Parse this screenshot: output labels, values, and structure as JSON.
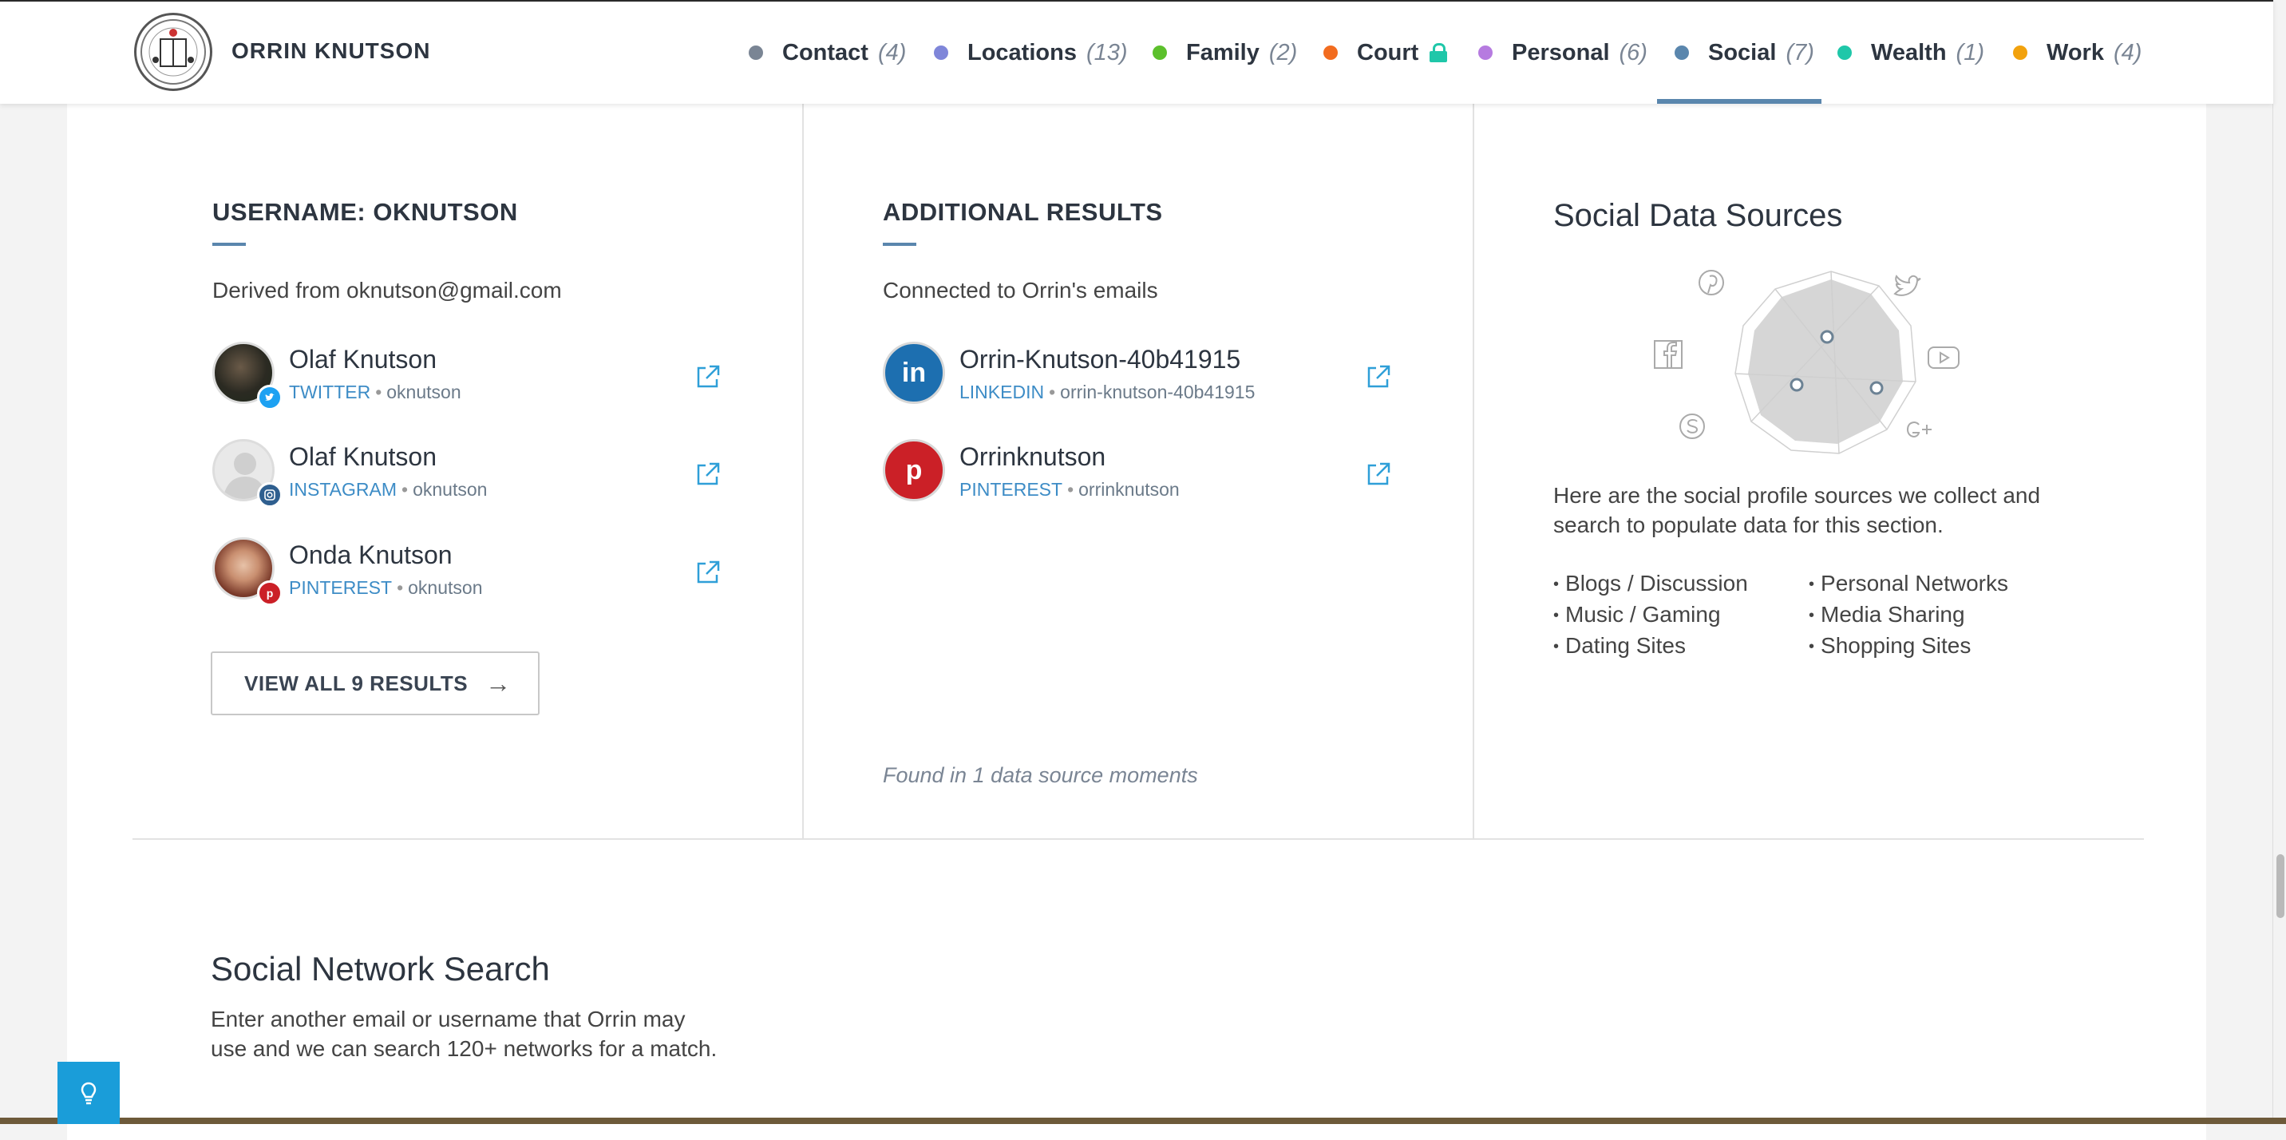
{
  "header": {
    "person_name": "ORRIN KNUTSON",
    "tabs": [
      {
        "label": "Contact",
        "count": "(4)",
        "dot_color": "#7a8594"
      },
      {
        "label": "Locations",
        "count": "(13)",
        "dot_color": "#7f86d9"
      },
      {
        "label": "Family",
        "count": "(2)",
        "dot_color": "#5cc02c"
      },
      {
        "label": "Court",
        "count": "",
        "dot_color": "#f26c1f",
        "locked": true
      },
      {
        "label": "Personal",
        "count": "(6)",
        "dot_color": "#b67be0"
      },
      {
        "label": "Social",
        "count": "(7)",
        "dot_color": "#5a86ad",
        "active": true
      },
      {
        "label": "Wealth",
        "count": "(1)",
        "dot_color": "#1fc7a9"
      },
      {
        "label": "Work",
        "count": "(4)",
        "dot_color": "#f2a20d"
      }
    ]
  },
  "username_section": {
    "title": "USERNAME: OKNUTSON",
    "subtitle": "Derived from oknutson@gmail.com",
    "results": [
      {
        "name": "Olaf Knutson",
        "network": "TWITTER",
        "handle": "oknutson",
        "badge_color": "#1da1f2",
        "badge_icon": "twitter-icon"
      },
      {
        "name": "Olaf Knutson",
        "network": "INSTAGRAM",
        "handle": "oknutson",
        "badge_color": "#2f5f8f",
        "badge_icon": "instagram-icon"
      },
      {
        "name": "Onda Knutson",
        "network": "PINTEREST",
        "handle": "oknutson",
        "badge_color": "#cb2027",
        "badge_icon": "pinterest-icon"
      }
    ],
    "view_all_label": "VIEW ALL 9 RESULTS",
    "view_all_arrow": "→"
  },
  "additional_section": {
    "title": "ADDITIONAL RESULTS",
    "subtitle": "Connected to Orrin's emails",
    "results": [
      {
        "name": "Orrin-Knutson-40b41915",
        "network": "LINKEDIN",
        "handle": "orrin-knutson-40b41915",
        "icon": "linkedin-icon",
        "icon_color": "#1d6fb0",
        "icon_text": "in"
      },
      {
        "name": "Orrinknutson",
        "network": "PINTEREST",
        "handle": "orrinknutson",
        "icon": "pinterest-icon",
        "icon_color": "#cb2027",
        "icon_text": "p"
      }
    ],
    "found_text": "Found in 1 data source moments"
  },
  "data_sources": {
    "title": "Social Data Sources",
    "description": "Here are the social profile sources we collect and search to populate data for this section.",
    "list_left": [
      "Blogs / Discussion",
      "Music / Gaming",
      "Dating Sites"
    ],
    "list_right": [
      "Personal Networks",
      "Media Sharing",
      "Shopping Sites"
    ]
  },
  "network_search": {
    "title": "Social Network Search",
    "description": "Enter another email or username that Orrin may use and we can search 120+ networks for a match."
  },
  "colors": {
    "accent": "#5a86ad",
    "link": "#3d8cc6",
    "help_button": "#1a9dd9"
  }
}
